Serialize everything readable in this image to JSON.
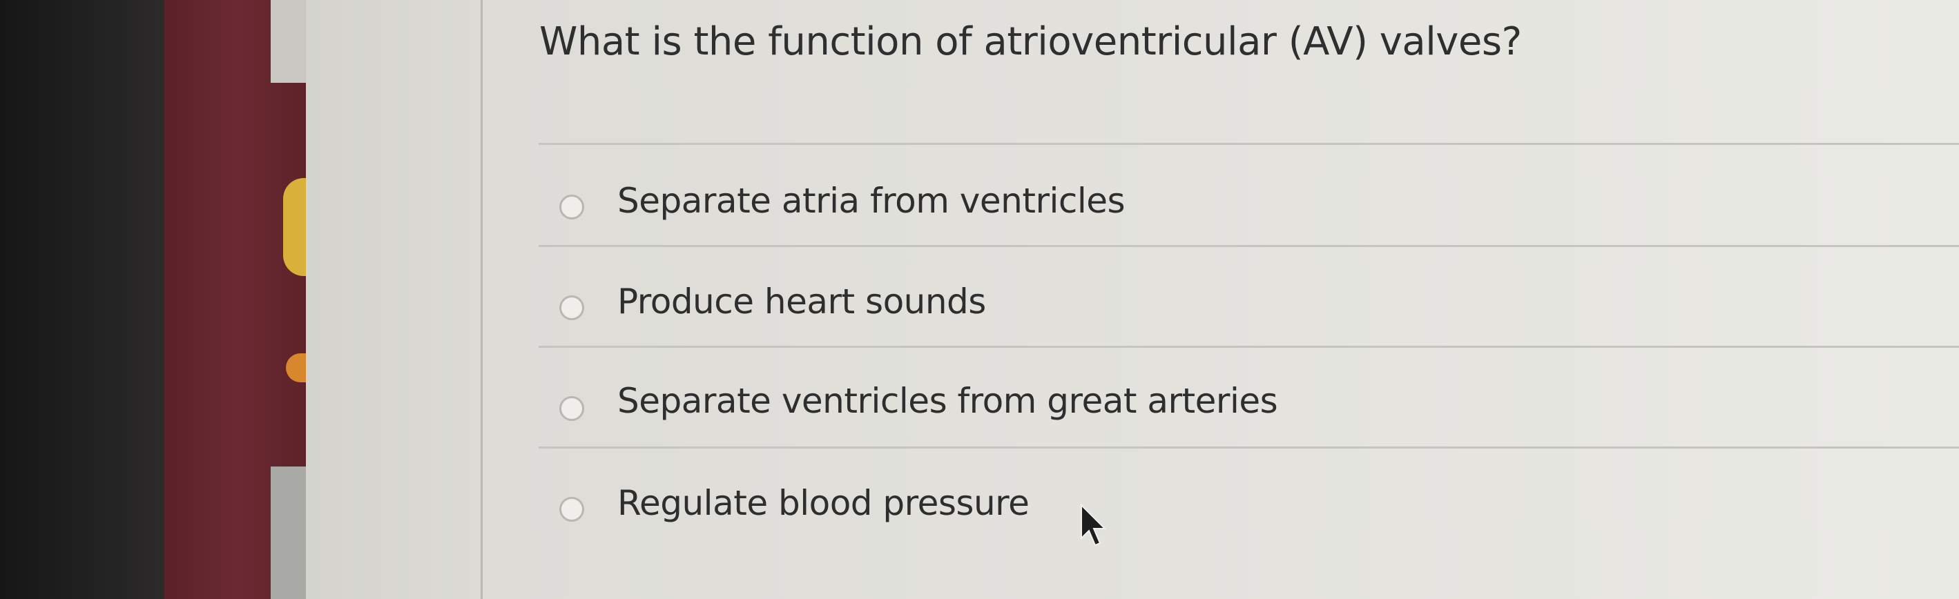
{
  "question": {
    "title": "What is the function of atrioventricular (AV) valves?"
  },
  "options": [
    {
      "label": "Separate atria from ventricles",
      "selected": false
    },
    {
      "label": "Produce heart sounds",
      "selected": false
    },
    {
      "label": "Separate ventricles from great arteries",
      "selected": false
    },
    {
      "label": "Regulate blood pressure",
      "selected": false
    }
  ],
  "icons": {
    "radio": "radio-button-icon",
    "cursor": "mouse-cursor-icon"
  },
  "colors": {
    "side_panel": "#6b2a33",
    "accent_yellow": "#d9b13a",
    "accent_orange": "#d9872c",
    "text": "#2f2f2f",
    "divider": "#c5c4bf"
  }
}
